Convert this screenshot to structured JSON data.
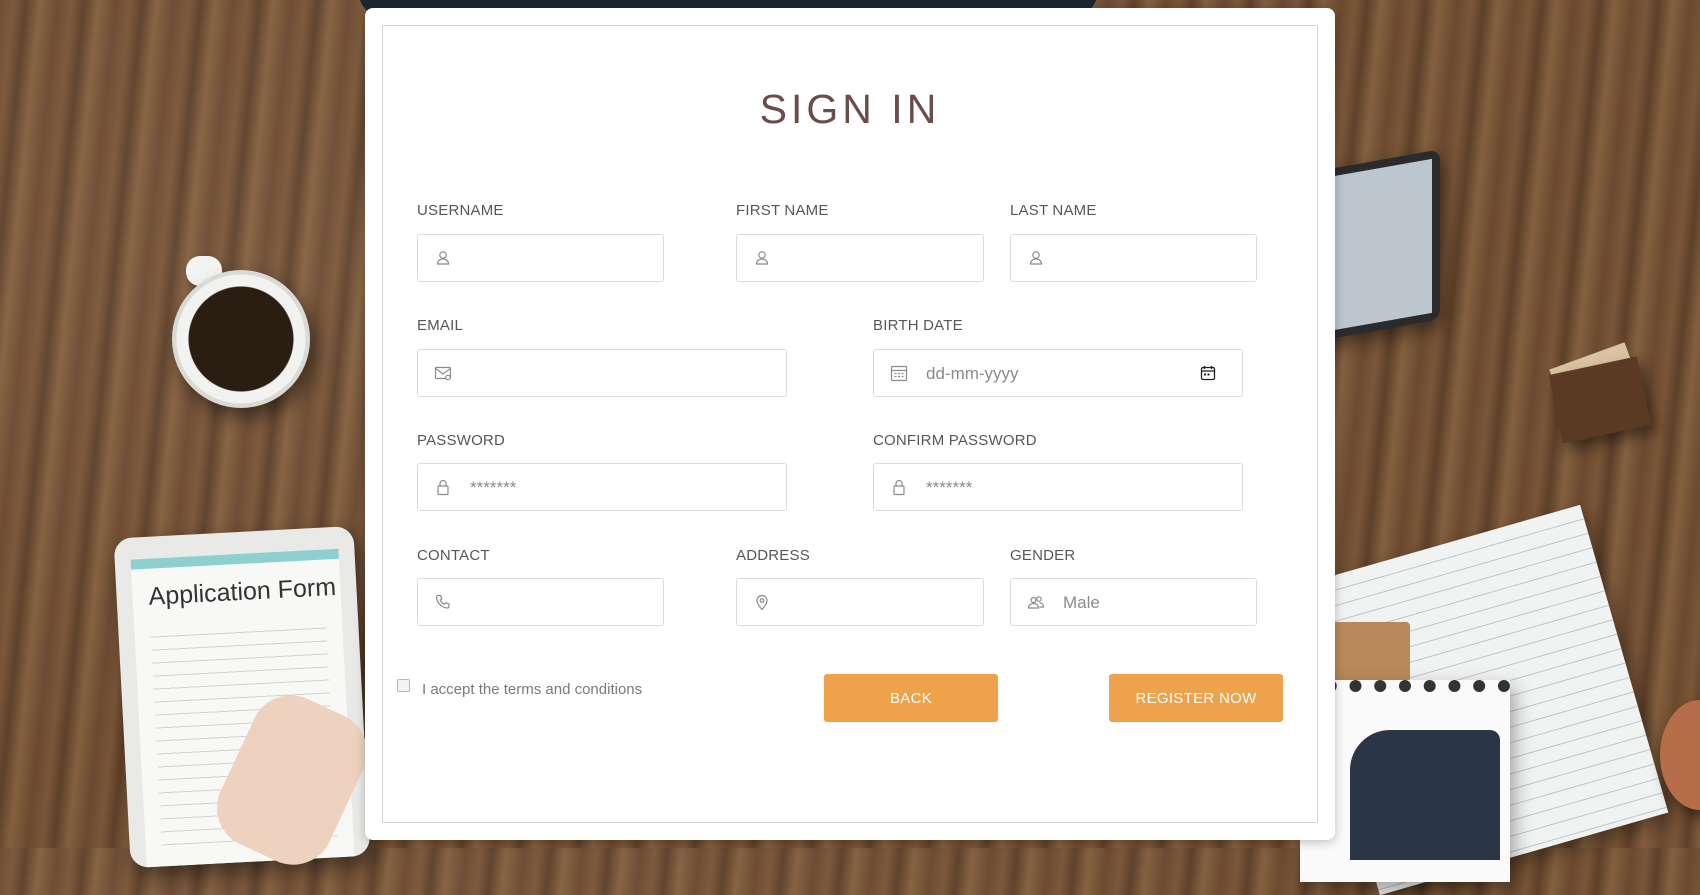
{
  "form": {
    "title": "SIGN IN",
    "fields": {
      "username": {
        "label": "USERNAME",
        "value": "",
        "icon": "user-icon"
      },
      "first_name": {
        "label": "FIRST NAME",
        "value": "",
        "icon": "user-icon"
      },
      "last_name": {
        "label": "LAST NAME",
        "value": "",
        "icon": "user-icon"
      },
      "email": {
        "label": "EMAIL",
        "value": "",
        "icon": "envelope-icon"
      },
      "birth_date": {
        "label": "BIRTH DATE",
        "placeholder": "dd-mm-yyyy",
        "icon": "calendar-icon",
        "picker_icon": "calendar-picker-icon"
      },
      "password": {
        "label": "PASSWORD",
        "placeholder": "*******",
        "icon": "lock-icon"
      },
      "confirm_password": {
        "label": "CONFIRM PASSWORD",
        "placeholder": "*******",
        "icon": "lock-icon"
      },
      "contact": {
        "label": "CONTACT",
        "value": "",
        "icon": "phone-icon"
      },
      "address": {
        "label": "ADDRESS",
        "value": "",
        "icon": "location-pin-icon"
      },
      "gender": {
        "label": "GENDER",
        "value": "Male",
        "icon": "users-icon"
      }
    },
    "terms_label": "I accept the terms and conditions",
    "back_label": "BACK",
    "register_label": "REGISTER NOW"
  },
  "background": {
    "tablet_text": "Application Form"
  },
  "colors": {
    "accent": "#eda24b",
    "title": "#6a4c49",
    "label": "#575757",
    "input_border": "#dcdcdc"
  }
}
